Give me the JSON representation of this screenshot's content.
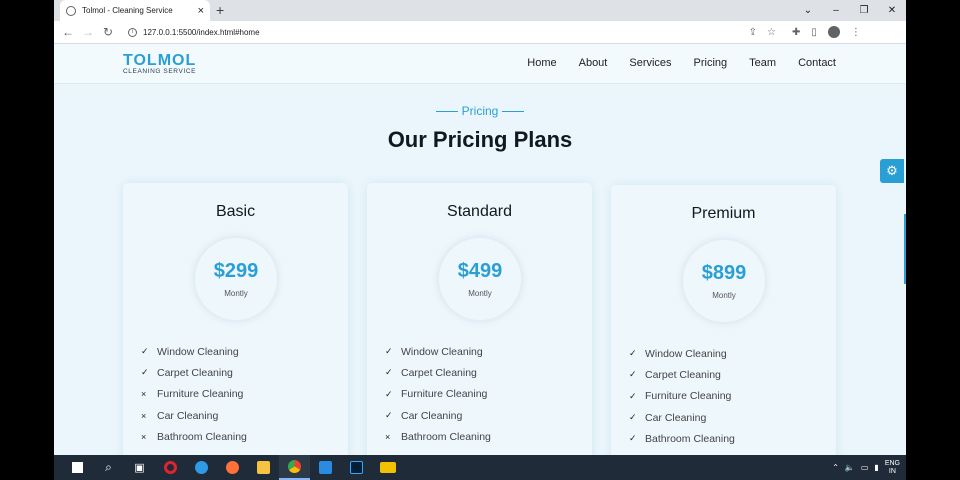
{
  "browser": {
    "tab_title": "Tolmol - Cleaning Service",
    "tab_close": "×",
    "new_tab": "+",
    "window_controls": [
      "⌄",
      "–",
      "❐",
      "✕"
    ],
    "url": "127.0.0.1:5500/index.html#home"
  },
  "site": {
    "logo_main": "TOLMOL",
    "logo_sub": "CLEANING SERVICE",
    "nav": [
      "Home",
      "About",
      "Services",
      "Pricing",
      "Team",
      "Contact"
    ]
  },
  "pricing": {
    "tag": "Pricing",
    "title": "Our Pricing Plans",
    "plans": [
      {
        "name": "Basic",
        "price": "$299",
        "period": "Montly",
        "features": [
          {
            "label": "Window Cleaning",
            "included": true
          },
          {
            "label": "Carpet Cleaning",
            "included": true
          },
          {
            "label": "Furniture Cleaning",
            "included": false
          },
          {
            "label": "Car Cleaning",
            "included": false
          },
          {
            "label": "Bathroom Cleaning",
            "included": false
          }
        ]
      },
      {
        "name": "Standard",
        "price": "$499",
        "period": "Montly",
        "features": [
          {
            "label": "Window Cleaning",
            "included": true
          },
          {
            "label": "Carpet Cleaning",
            "included": true
          },
          {
            "label": "Furniture Cleaning",
            "included": true
          },
          {
            "label": "Car Cleaning",
            "included": true
          },
          {
            "label": "Bathroom Cleaning",
            "included": false
          }
        ]
      },
      {
        "name": "Premium",
        "price": "$899",
        "period": "Montly",
        "features": [
          {
            "label": "Window Cleaning",
            "included": true
          },
          {
            "label": "Carpet Cleaning",
            "included": true
          },
          {
            "label": "Furniture Cleaning",
            "included": true
          },
          {
            "label": "Car Cleaning",
            "included": true
          },
          {
            "label": "Bathroom Cleaning",
            "included": true
          }
        ]
      }
    ]
  },
  "icons": {
    "check": "✓",
    "cross": "×",
    "gear": "⚙"
  },
  "colors": {
    "accent": "#2a9fd6",
    "page_bg": "#eaf6fc",
    "taskbar": "#1f2b38"
  },
  "taskbar": {
    "apps": [
      {
        "name": "windows-start-icon",
        "color": "#ffffff"
      },
      {
        "name": "search-icon",
        "color": "#ffffff"
      },
      {
        "name": "task-view-icon",
        "color": "#ffffff"
      },
      {
        "name": "opera-icon",
        "color": "#e0242f"
      },
      {
        "name": "edge-icon",
        "color": "#2d9be6"
      },
      {
        "name": "firefox-icon",
        "color": "#ff7139"
      },
      {
        "name": "file-explorer-icon",
        "color": "#f5c242"
      },
      {
        "name": "chrome-icon",
        "color": "#4caf50"
      },
      {
        "name": "vscode-icon",
        "color": "#2b8be0"
      },
      {
        "name": "photoshop-icon",
        "color": "#31a8ff"
      },
      {
        "name": "tool-icon",
        "color": "#f2c200"
      }
    ],
    "lang_line1": "ENG",
    "lang_line2": "IN"
  }
}
